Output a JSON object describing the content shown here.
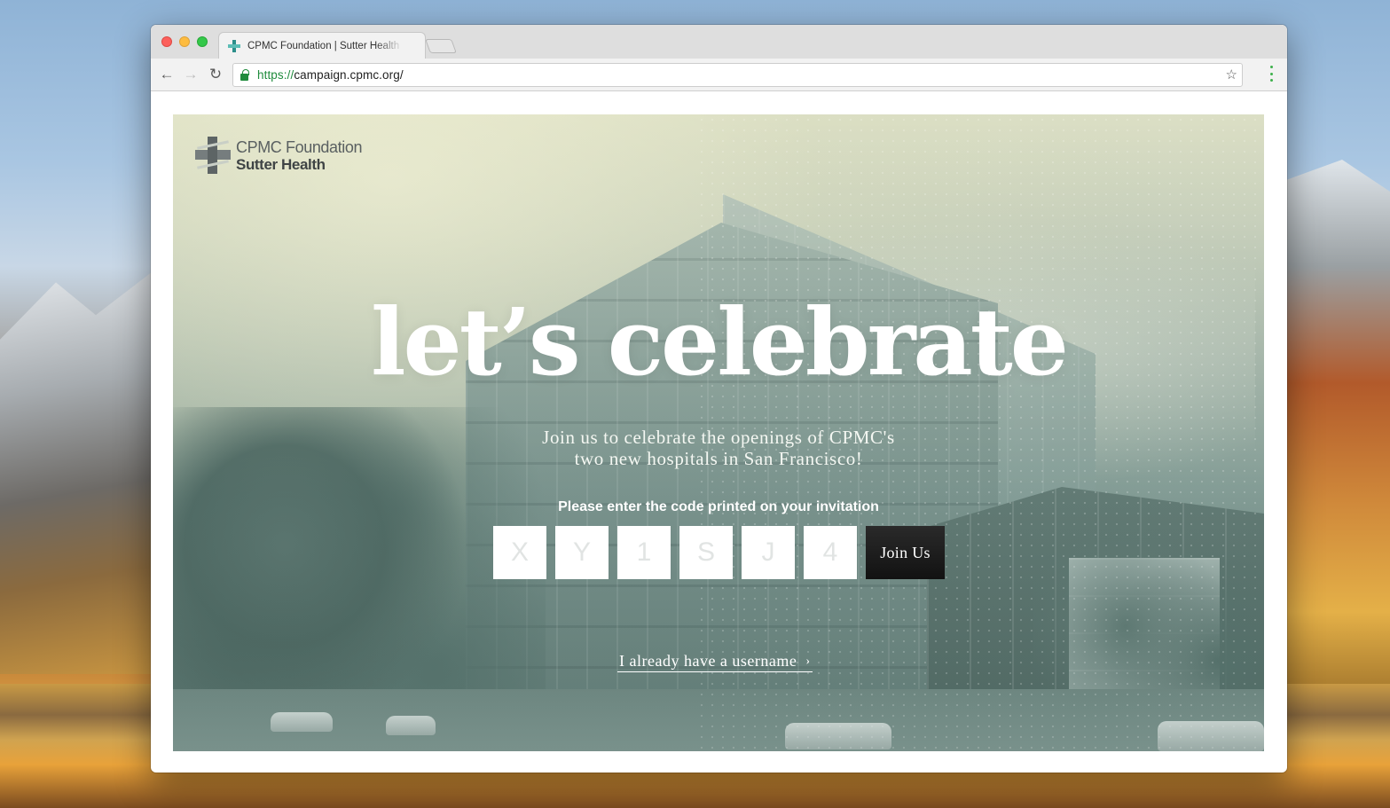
{
  "browser": {
    "tab_title": "CPMC Foundation | Sutter Health",
    "url_scheme": "https://",
    "url_rest": "campaign.cpmc.org/"
  },
  "logo": {
    "line1": "CPMC Foundation",
    "line2": "Sutter Health"
  },
  "hero": {
    "headline": "let’s celebrate",
    "subhead_line1": "Join us to celebrate the openings of CPMC's",
    "subhead_line2": "two new hospitals in San Francisco!",
    "prompt": "Please enter the code printed on your invitation",
    "code_placeholders": [
      "X",
      "Y",
      "1",
      "S",
      "J",
      "4"
    ],
    "join_label": "Join Us",
    "username_link": "I already have a username",
    "chevron": "›"
  },
  "icons": {
    "back": "←",
    "forward": "→",
    "reload": "↻",
    "star": "☆"
  }
}
